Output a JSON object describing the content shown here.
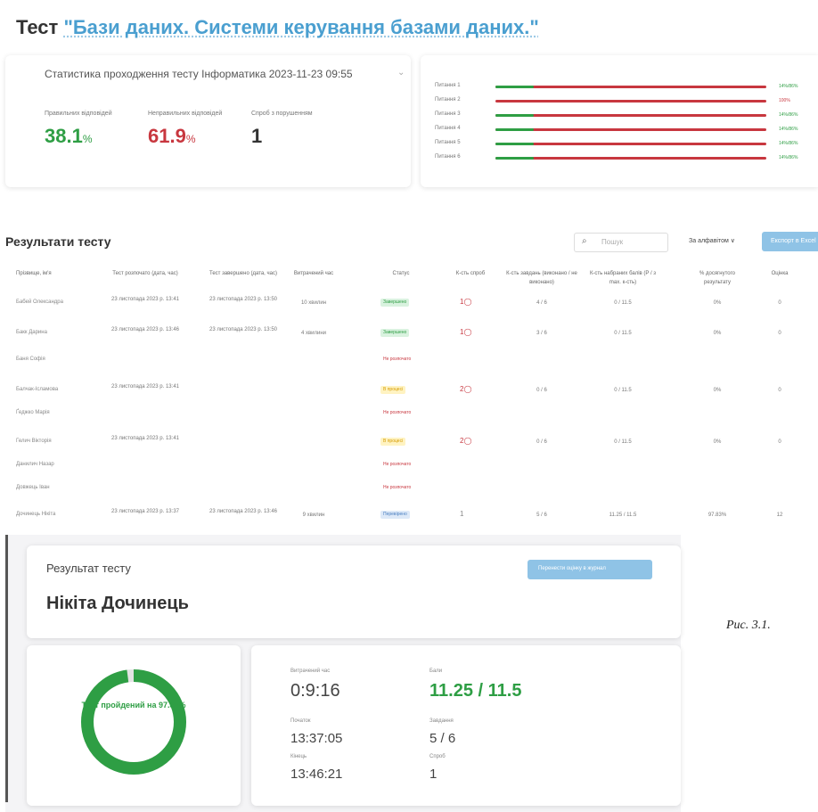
{
  "header": {
    "prefix": "Тест",
    "test_name": "\"Бази даних. Системи керування базами даних.\""
  },
  "stats": {
    "title": "Статистика проходження тесту Інформатика 2023-11-23 09:55",
    "correct_label": "Правильних відповідей",
    "correct_value": "38.1",
    "wrong_label": "Неправильних відповідей",
    "wrong_value": "61.9",
    "percent_unit": "%",
    "attempts_label": "Спроб з порушенням",
    "attempts_value": "1",
    "colors": {
      "correct": "#2e9e44",
      "wrong": "#c8373f"
    }
  },
  "questions": [
    {
      "label": "Питання 1",
      "correct_fraction": 0.14,
      "pct": "14%/86%"
    },
    {
      "label": "Питання 2",
      "correct_fraction": 0.0,
      "pct": "100%"
    },
    {
      "label": "Питання 3",
      "correct_fraction": 0.14,
      "pct": "14%/86%"
    },
    {
      "label": "Питання 4",
      "correct_fraction": 0.14,
      "pct": "14%/86%"
    },
    {
      "label": "Питання 5",
      "correct_fraction": 0.14,
      "pct": "14%/86%"
    },
    {
      "label": "Питання 6",
      "correct_fraction": 0.14,
      "pct": "14%/86%"
    }
  ],
  "results": {
    "title": "Результати тесту",
    "search_placeholder": "Пошук",
    "sort_label": "За алфавітом ∨",
    "export_label": "Експорт в Excel",
    "search_icon": "search-icon",
    "columns": [
      "Прізвище, ім'я",
      "Тест розпочато (дата, час)",
      "Тест завершено (дата, час)",
      "Витрачений час",
      "Статус",
      "К-сть спроб",
      "К-сть завдань (виконано / не виконано)",
      "К-сть набраних балів (P / з max. к-сть)",
      "% досягнутого результату",
      "Оцінка"
    ],
    "rows": [
      {
        "name": "Бабей Олександра",
        "start": "23 листопада 2023 р. 13:41",
        "end": "23 листопада 2023 р. 13:50",
        "time": "10 хвилин",
        "status": "Завершено",
        "status_type": "done",
        "attempts": "1◯",
        "tasks": "4 / 6",
        "points": "0 / 11.5",
        "percent": "0%",
        "grade": "0"
      },
      {
        "name": "Бакк Дарина",
        "start": "23 листопада 2023 р. 13:46",
        "end": "23 листопада 2023 р. 13:50",
        "time": "4 хвилини",
        "status": "Завершено",
        "status_type": "done",
        "attempts": "1◯",
        "tasks": "3 / 6",
        "points": "0 / 11.5",
        "percent": "0%",
        "grade": "0"
      },
      {
        "name": "Баня Софія",
        "start": "",
        "end": "",
        "time": "",
        "status": "Не розпочато",
        "status_type": "not",
        "attempts": "",
        "tasks": "",
        "points": "",
        "percent": "",
        "grade": ""
      },
      {
        "name": "Балчак-Ісламова",
        "start": "23 листопада 2023 р. 13:41",
        "end": "",
        "time": "",
        "status": "В процесі",
        "status_type": "prog",
        "attempts": "2◯",
        "tasks": "0 / 6",
        "points": "0 / 11.5",
        "percent": "0%",
        "grade": "0"
      },
      {
        "name": "Ґеджко Марія",
        "start": "",
        "end": "",
        "time": "",
        "status": "Не розпочато",
        "status_type": "not",
        "attempts": "",
        "tasks": "",
        "points": "",
        "percent": "",
        "grade": ""
      },
      {
        "name": "Гелич Вікторія",
        "start": "23 листопада 2023 р. 13:41",
        "end": "",
        "time": "",
        "status": "В процесі",
        "status_type": "prog",
        "attempts": "2◯",
        "tasks": "0 / 6",
        "points": "0 / 11.5",
        "percent": "0%",
        "grade": "0"
      },
      {
        "name": "Данилич Назар",
        "start": "",
        "end": "",
        "time": "",
        "status": "Не розпочато",
        "status_type": "not",
        "attempts": "",
        "tasks": "",
        "points": "",
        "percent": "",
        "grade": ""
      },
      {
        "name": "Довжець Іван",
        "start": "",
        "end": "",
        "time": "",
        "status": "Не розпочато",
        "status_type": "not",
        "attempts": "",
        "tasks": "",
        "points": "",
        "percent": "",
        "grade": ""
      },
      {
        "name": "Дочинець Нікіта",
        "start": "23 листопада 2023 р. 13:37",
        "end": "23 листопада 2023 р. 13:46",
        "time": "9 хвилин",
        "status": "Перевірено",
        "status_type": "rev",
        "attempts": "1",
        "tasks": "5 / 6",
        "points": "11.25 / 11.5",
        "percent": "97.83%",
        "grade": "12"
      }
    ]
  },
  "result_panel": {
    "title": "Результат тесту",
    "student": "Нікіта Дочинець",
    "journal_button": "Перенести оцінку в журнал",
    "donut_text": "Тест пройдений на 97.83%",
    "donut_fraction": 0.9783,
    "time_label": "Витрачений час",
    "time_value": "0:9:16",
    "points_label": "Бали",
    "points_value": "11.25 / 11.5",
    "start_label": "Початок",
    "start_value": "13:37:05",
    "tasks_label": "Завдання",
    "tasks_value": "5 / 6",
    "end_label": "Кінець",
    "end_value": "13:46:21",
    "attempts_label": "Спроб",
    "attempts_value": "1"
  },
  "caption": "Рис. 3.1."
}
